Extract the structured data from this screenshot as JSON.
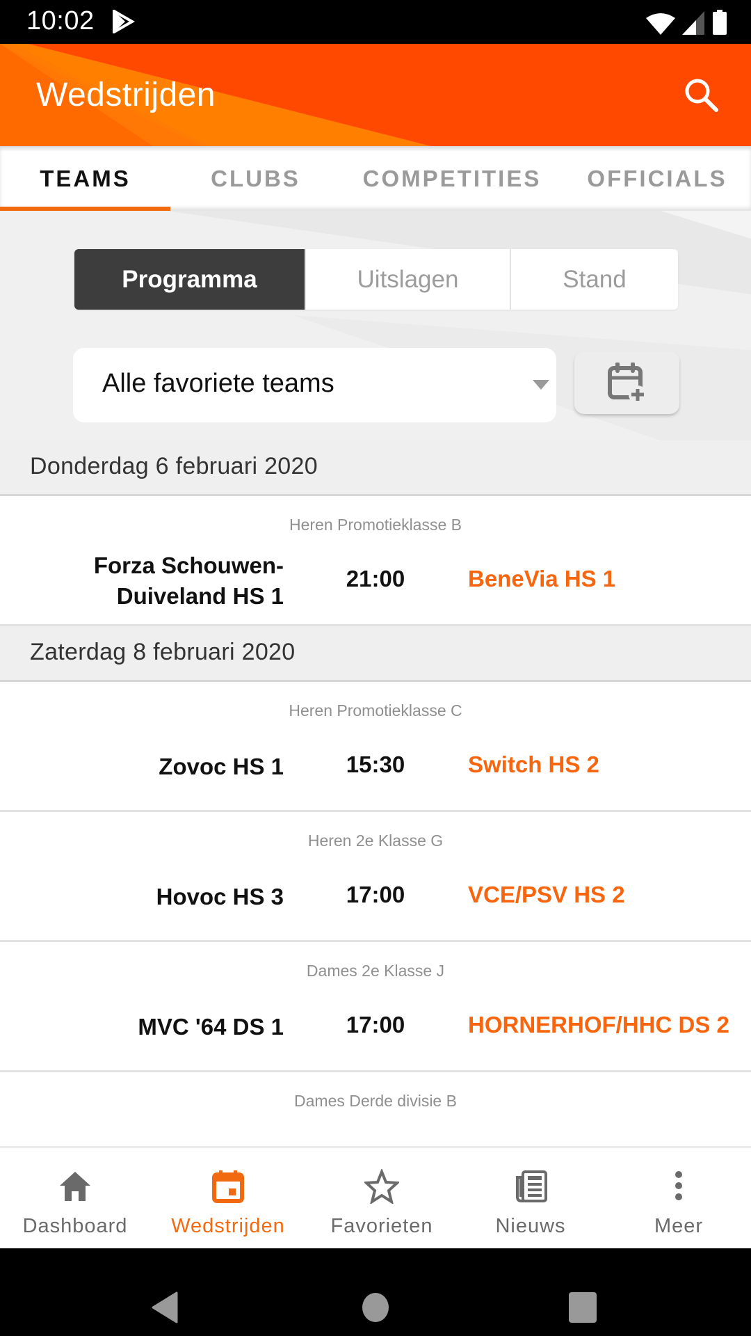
{
  "status_bar": {
    "time": "10:02",
    "icons": [
      "play-store-icon",
      "wifi-icon",
      "signal-icon",
      "battery-icon"
    ]
  },
  "app_bar": {
    "title": "Wedstrijden",
    "search_icon": "search-icon",
    "brand_color": "#ff4800"
  },
  "tabs": [
    {
      "label": "TEAMS",
      "active": true
    },
    {
      "label": "CLUBS",
      "active": false
    },
    {
      "label": "COMPETITIES",
      "active": false
    },
    {
      "label": "OFFICIALS",
      "active": false
    }
  ],
  "segmented": [
    {
      "label": "Programma",
      "active": true
    },
    {
      "label": "Uitslagen",
      "active": false
    },
    {
      "label": "Stand",
      "active": false
    }
  ],
  "filter": {
    "selected": "Alle favoriete teams",
    "calendar_button_icon": "calendar-plus-icon"
  },
  "days": [
    {
      "date": "Donderdag 6 februari 2020",
      "matches": [
        {
          "league": "Heren Promotieklasse B",
          "home": "Forza Schouwen-Duiveland HS 1",
          "home_line1": "Forza Schouwen-",
          "home_line2": "Duiveland HS 1",
          "time": "21:00",
          "away": "BeneVia HS 1"
        }
      ]
    },
    {
      "date": "Zaterdag 8 februari 2020",
      "matches": [
        {
          "league": "Heren Promotieklasse C",
          "home": "Zovoc HS 1",
          "time": "15:30",
          "away": "Switch HS 2"
        },
        {
          "league": "Heren 2e Klasse G",
          "home": "Hovoc HS 3",
          "time": "17:00",
          "away": "VCE/PSV HS 2"
        },
        {
          "league": "Dames 2e Klasse J",
          "home": "MVC '64 DS 1",
          "time": "17:00",
          "away": "HORNERHOF/HHC DS 2"
        },
        {
          "league": "Dames Derde divisie B"
        }
      ]
    }
  ],
  "bottom_nav": [
    {
      "label": "Dashboard",
      "icon": "home-icon",
      "active": false
    },
    {
      "label": "Wedstrijden",
      "icon": "calendar-icon",
      "active": true
    },
    {
      "label": "Favorieten",
      "icon": "star-icon",
      "active": false
    },
    {
      "label": "Nieuws",
      "icon": "newspaper-icon",
      "active": false
    },
    {
      "label": "Meer",
      "icon": "more-vert-icon",
      "active": false
    }
  ],
  "colors": {
    "accent": "#f26a10",
    "away_team": "#f7650e",
    "segment_active": "#3d3d3d"
  }
}
